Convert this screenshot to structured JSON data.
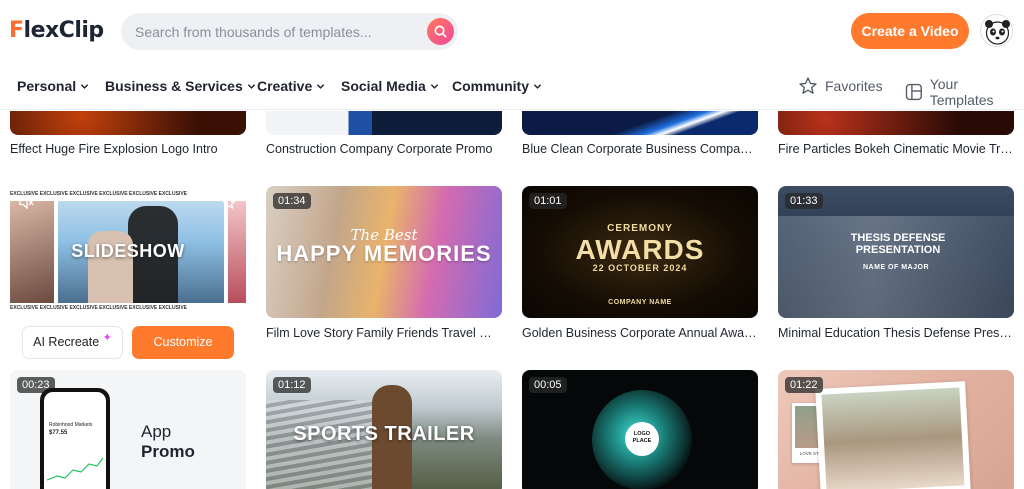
{
  "header": {
    "logo": "FlexClip",
    "search_placeholder": "Search from thousands of templates...",
    "create_label": "Create a Video"
  },
  "nav": {
    "items": [
      "Personal",
      "Business & Services",
      "Creative",
      "Social Media",
      "Community"
    ],
    "favorites": "Favorites",
    "your_templates": "Your Templates"
  },
  "row1": [
    {
      "title": "Effect Huge Fire Explosion Logo Intro"
    },
    {
      "title": "Construction Company Corporate Promo"
    },
    {
      "title": "Blue Clean Corporate Business Company P..."
    },
    {
      "title": "Fire Particles Bokeh Cinematic Movie Trailer"
    }
  ],
  "row2": [
    {
      "title": "",
      "overlay": "SLIDESHOW",
      "banner": "EXCLUSIVE EXCLUSIVE EXCLUSIVE EXCLUSIVE EXCLUSIVE EXCLUSIVE",
      "ai_label": "AI Recreate",
      "customize_label": "Customize"
    },
    {
      "duration": "01:34",
      "title": "Film Love Story Family Friends Travel Mem...",
      "overlay_small": "The Best",
      "overlay": "HAPPY MEMORIES"
    },
    {
      "duration": "01:01",
      "title": "Golden Business Corporate Annual Award ...",
      "overlay_small": "CEREMONY",
      "overlay": "AWARDS",
      "overlay_date": "22 OCTOBER 2024",
      "overlay_company": "COMPANY NAME"
    },
    {
      "duration": "01:33",
      "title": "Minimal Education Thesis Defense Present...",
      "overlay": "THESIS DEFENSE PRESENTATION",
      "overlay_small": "NAME OF MAJOR"
    }
  ],
  "row3": [
    {
      "duration": "00:23",
      "overlay": "App",
      "overlay2": "Promo",
      "phone_line1": "Robinhood Markets",
      "phone_line2": "$77.55"
    },
    {
      "duration": "01:12",
      "overlay": "SPORTS TRAILER"
    },
    {
      "duration": "00:05",
      "overlay": "LOGO PLACE"
    },
    {
      "duration": "01:22",
      "overlay": "LOVE STORY"
    }
  ]
}
